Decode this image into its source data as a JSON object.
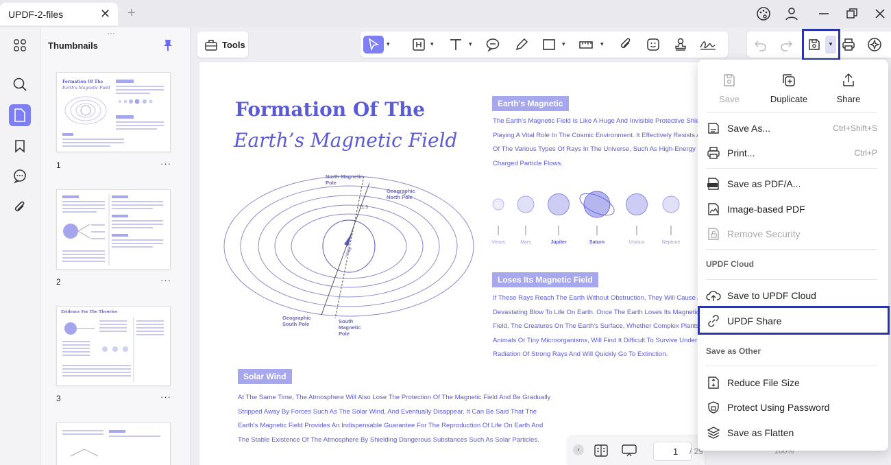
{
  "tab": {
    "title": "UPDF-2-files"
  },
  "thumbnails": {
    "title": "Thumbnails",
    "pages": [
      {
        "number": "1",
        "mini_title": "Formation Of The",
        "mini_subtitle": "Earth's Magnetic Field"
      },
      {
        "number": "2"
      },
      {
        "number": "3",
        "mini_title": "Evidence For The Theories"
      }
    ],
    "more": "···"
  },
  "toolbar": {
    "tools_label": "Tools"
  },
  "document": {
    "title_line1": "Formation Of The",
    "title_line2": "Earth’s Magnetic Field",
    "section1_heading": "Earth's Magnetic",
    "section1_lines": [
      "The Earth's Magnetic Field Is Like A Huge And Invisible Protective Shie",
      "Playing A Vital Role In The Cosmic Environment. It Effectively Resists A",
      "Of The Various Types Of Rays In The Universe, Such As High-Energy",
      "Charged Particle Flows."
    ],
    "planets": [
      "Venus",
      "Mars",
      "Jupiter",
      "Saturn",
      "Uranus",
      "Neptune"
    ],
    "section2_heading": "Loses Its Magnetic Field",
    "section2_lines": [
      "If These Rays Reach The Earth Without Obstruction, They Will Cause A",
      "Devastating Blow To Life On Earth. Once The Earth Loses Its Magnetic",
      "Field, The Creatures On The Earth's Surface, Whether Complex Plants",
      "Animals Or Tiny Microorganisms, Will Find It Difficult To Survive Under",
      "Radiation Of Strong Rays And Will Quickly Go To Extinction."
    ],
    "section3_heading": "Solar Wind",
    "section3_lines": [
      "At The Same Time, The Atmosphere Will Also Lose The Protection Of The Magnetic Field And Be Gradually",
      "Stripped Away By Forces Such As The Solar Wind, And Eventually Disappear. It Can Be Said That The",
      "Earth's Magnetic Field Provides An Indispensable Guarantee For The Reproduction Of Life On Earth And",
      "The Stable Existence Of The Atmosphere By Shielding Dangerous Substances Such As Solar Particles."
    ],
    "diagram": {
      "north_magnetic_pole": "North Magnetic Pole",
      "geographic_north_pole": "Geographic North Pole",
      "geographic_south_pole": "Geographic South Pole",
      "south_magnetic_pole": "South Magnetic Pole",
      "angle": "11.5"
    }
  },
  "pagebar": {
    "current_page": "1",
    "total": "/ 29",
    "zoom": "100%"
  },
  "menu": {
    "save": "Save",
    "duplicate": "Duplicate",
    "share": "Share",
    "items": [
      {
        "label": "Save As...",
        "shortcut": "Ctrl+Shift+S"
      },
      {
        "label": "Print...",
        "shortcut": "Ctrl+P"
      },
      {
        "label": "Save as PDF/A..."
      },
      {
        "label": "Image-based PDF"
      },
      {
        "label": "Remove Security"
      }
    ],
    "cloud_heading": "UPDF Cloud",
    "cloud_items": [
      {
        "label": "Save to UPDF Cloud"
      },
      {
        "label": "UPDF Share"
      }
    ],
    "other_heading": "Save as Other",
    "other_items": [
      {
        "label": "Reduce File Size"
      },
      {
        "label": "Protect Using Password"
      },
      {
        "label": "Save as Flatten"
      }
    ]
  }
}
